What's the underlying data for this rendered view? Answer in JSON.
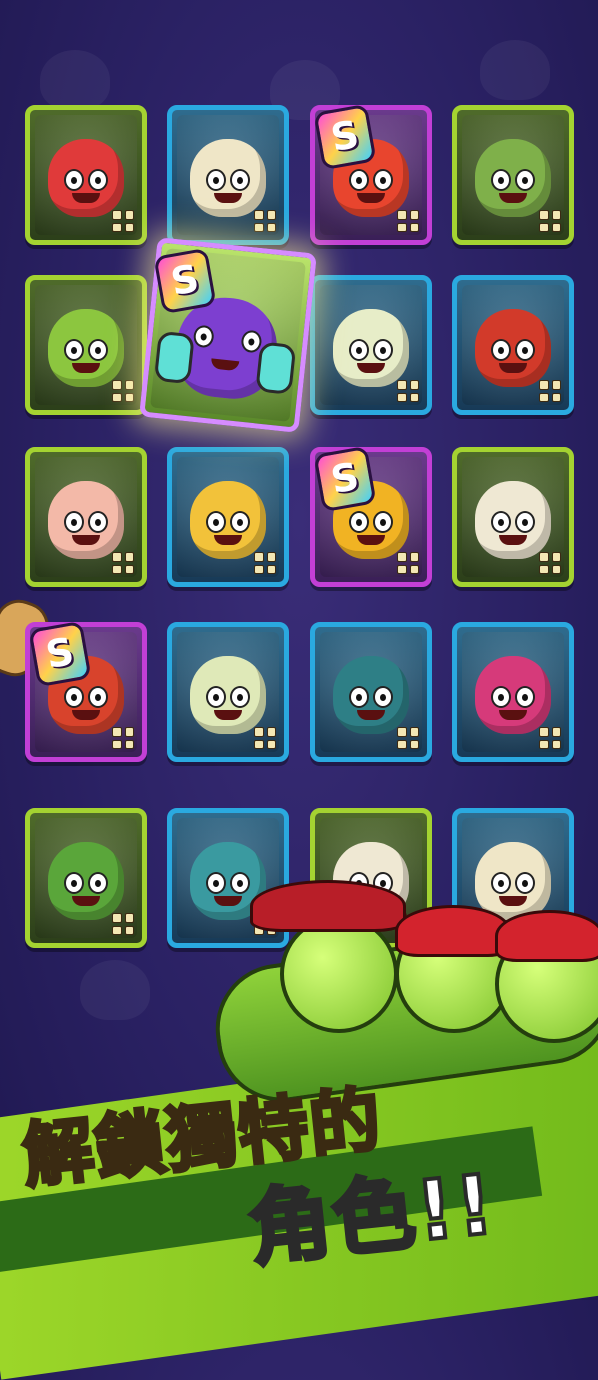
{
  "headline": {
    "line1": "解鎖獨特的",
    "line2": "角色!!"
  },
  "featured_character": {
    "rarity_badge": "S"
  },
  "character_rows": [
    [
      {
        "frame": "green",
        "rarity_badge": "",
        "color": "#e03a3a",
        "name": "strawberry"
      },
      {
        "frame": "blue",
        "rarity_badge": "",
        "color": "#efe6c7",
        "name": "cauliflower-ram"
      },
      {
        "frame": "purple",
        "rarity_badge": "S",
        "color": "#e8452e",
        "name": "super-tomato"
      },
      {
        "frame": "green",
        "rarity_badge": "",
        "color": "#7fb04a",
        "name": "artichoke"
      }
    ],
    [
      {
        "frame": "green",
        "rarity_badge": "",
        "color": "#8cc63f",
        "name": "pea-pirate"
      },
      {
        "frame": "",
        "rarity_badge": "",
        "color": "",
        "name": "placeholder"
      },
      {
        "frame": "blue",
        "rarity_badge": "",
        "color": "#e7edc8",
        "name": "leek"
      },
      {
        "frame": "blue",
        "rarity_badge": "",
        "color": "#d23a2a",
        "name": "chili"
      }
    ],
    [
      {
        "frame": "green",
        "rarity_badge": "",
        "color": "#f3b9a8",
        "name": "peach-nurse"
      },
      {
        "frame": "blue",
        "rarity_badge": "",
        "color": "#f2c23a",
        "name": "mushroom-sunglasses"
      },
      {
        "frame": "purple",
        "rarity_badge": "S",
        "color": "#f1b323",
        "name": "spartan-potato"
      },
      {
        "frame": "green",
        "rarity_badge": "",
        "color": "#efe8d3",
        "name": "garlic-hammer"
      }
    ],
    [
      {
        "frame": "purple",
        "rarity_badge": "S",
        "color": "#d8432c",
        "name": "acorn-warrior"
      },
      {
        "frame": "blue",
        "rarity_badge": "",
        "color": "#dfe9b8",
        "name": "bamboo-rock"
      },
      {
        "frame": "blue",
        "rarity_badge": "",
        "color": "#2e7f86",
        "name": "blueberry-lightning"
      },
      {
        "frame": "blue",
        "rarity_badge": "",
        "color": "#d63a7a",
        "name": "beet-wizard"
      }
    ],
    [
      {
        "frame": "green",
        "rarity_badge": "",
        "color": "#5aa63a",
        "name": "pepper-lightning"
      },
      {
        "frame": "blue",
        "rarity_badge": "",
        "color": "#3a9aa0",
        "name": "cabbage-glasses"
      },
      {
        "frame": "green",
        "rarity_badge": "",
        "color": "#efe8d3",
        "name": "garlic"
      },
      {
        "frame": "blue",
        "rarity_badge": "",
        "color": "#efe6c7",
        "name": "cauliflower"
      }
    ]
  ]
}
